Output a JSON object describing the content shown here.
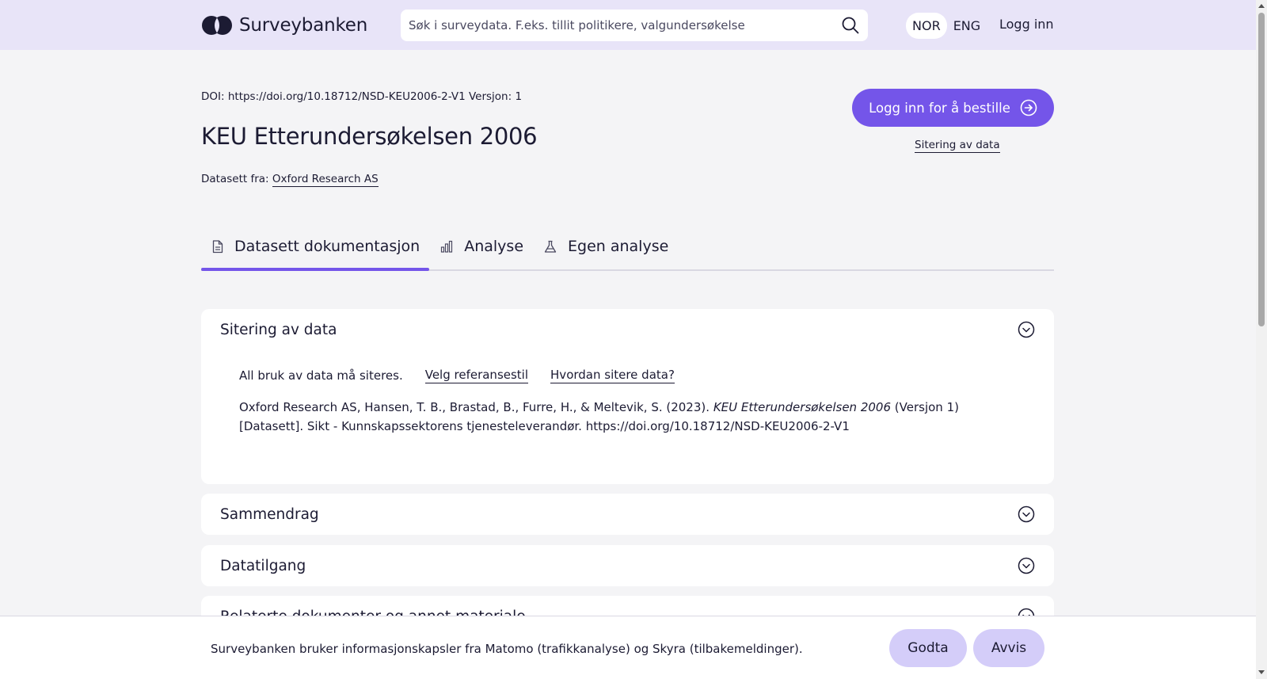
{
  "header": {
    "logo_text": "Surveybanken",
    "search_placeholder": "Søk i surveydata. F.eks. tillit politikere, valgundersøkelse",
    "languages": [
      "NOR",
      "ENG"
    ],
    "active_language": "NOR",
    "login_label": "Logg inn"
  },
  "dataset": {
    "doi_line": "DOI: https://doi.org/10.18712/NSD-KEU2006-2-V1 Versjon: 1",
    "title": "KEU Etterundersøkelsen 2006",
    "source_prefix": "Datasett fra:",
    "source_name": "Oxford Research AS",
    "order_button": "Logg inn for å bestille",
    "citation_link": "Sitering av data"
  },
  "tabs": [
    {
      "label": "Datasett dokumentasjon",
      "icon": "document-icon",
      "active": true
    },
    {
      "label": "Analyse",
      "icon": "bar-chart-icon",
      "active": false
    },
    {
      "label": "Egen analyse",
      "icon": "flask-icon",
      "active": false
    }
  ],
  "sections": {
    "citation": {
      "title": "Sitering av data",
      "intro": "All bruk av data må siteres.",
      "link_style": "Velg referansestil",
      "link_how": "Hvordan sitere data?",
      "citation_authors": "Oxford Research AS, Hansen, T. B., Brastad, B., Furre, H., & Meltevik, S. (2023).",
      "citation_title": "KEU Etterundersøkelsen 2006",
      "citation_rest": "(Versjon 1) [Datasett]. Sikt - Kunnskapssektorens tjenesteleverandør. https://doi.org/10.18712/NSD-KEU2006-2-V1"
    },
    "summary": {
      "title": "Sammendrag"
    },
    "access": {
      "title": "Datatilgang"
    },
    "related": {
      "title": "Relaterte dokumenter og annet materiale"
    }
  },
  "cookie_banner": {
    "text": "Surveybanken bruker informasjonskapsler fra Matomo (trafikkanalyse) og Skyra (tilbakemeldinger).",
    "accept": "Godta",
    "reject": "Avvis"
  },
  "colors": {
    "accent": "#7455e9",
    "header_bg": "#e8e4f8",
    "cookie_button": "#d4cdf9",
    "page_bg": "#f4f4f6",
    "text": "#1c1b33"
  }
}
